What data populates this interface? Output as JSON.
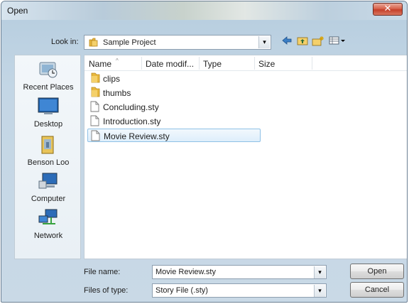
{
  "window": {
    "title": "Open",
    "close_glyph": "✕"
  },
  "toolbar": {
    "look_in_label": "Look in:",
    "look_in_value": "Sample Project",
    "dropdown_glyph": "▾",
    "icons": [
      "back-arrow-icon",
      "up-folder-icon",
      "new-folder-icon",
      "views-menu-icon"
    ]
  },
  "places": [
    {
      "label": "Recent Places",
      "icon": "recent-places-icon"
    },
    {
      "label": "Desktop",
      "icon": "desktop-icon"
    },
    {
      "label": "Benson Loo",
      "icon": "user-folder-icon"
    },
    {
      "label": "Computer",
      "icon": "computer-icon"
    },
    {
      "label": "Network",
      "icon": "network-icon"
    }
  ],
  "columns": [
    "Name",
    "Date modif...",
    "Type",
    "Size"
  ],
  "files": [
    {
      "name": "clips",
      "kind": "folder"
    },
    {
      "name": "thumbs",
      "kind": "folder"
    },
    {
      "name": "Concluding.sty",
      "kind": "file"
    },
    {
      "name": "Introduction.sty",
      "kind": "file"
    },
    {
      "name": "Movie Review.sty",
      "kind": "file",
      "selected": true
    }
  ],
  "footer": {
    "file_name_label": "File name:",
    "file_name_value": "Movie Review.sty",
    "file_type_label": "Files of type:",
    "file_type_value": "Story File (.sty)",
    "open_label": "Open",
    "cancel_label": "Cancel"
  },
  "colors": {
    "selection": "#deeefb",
    "folder": "#e8b83e",
    "close": "#c4402a"
  }
}
